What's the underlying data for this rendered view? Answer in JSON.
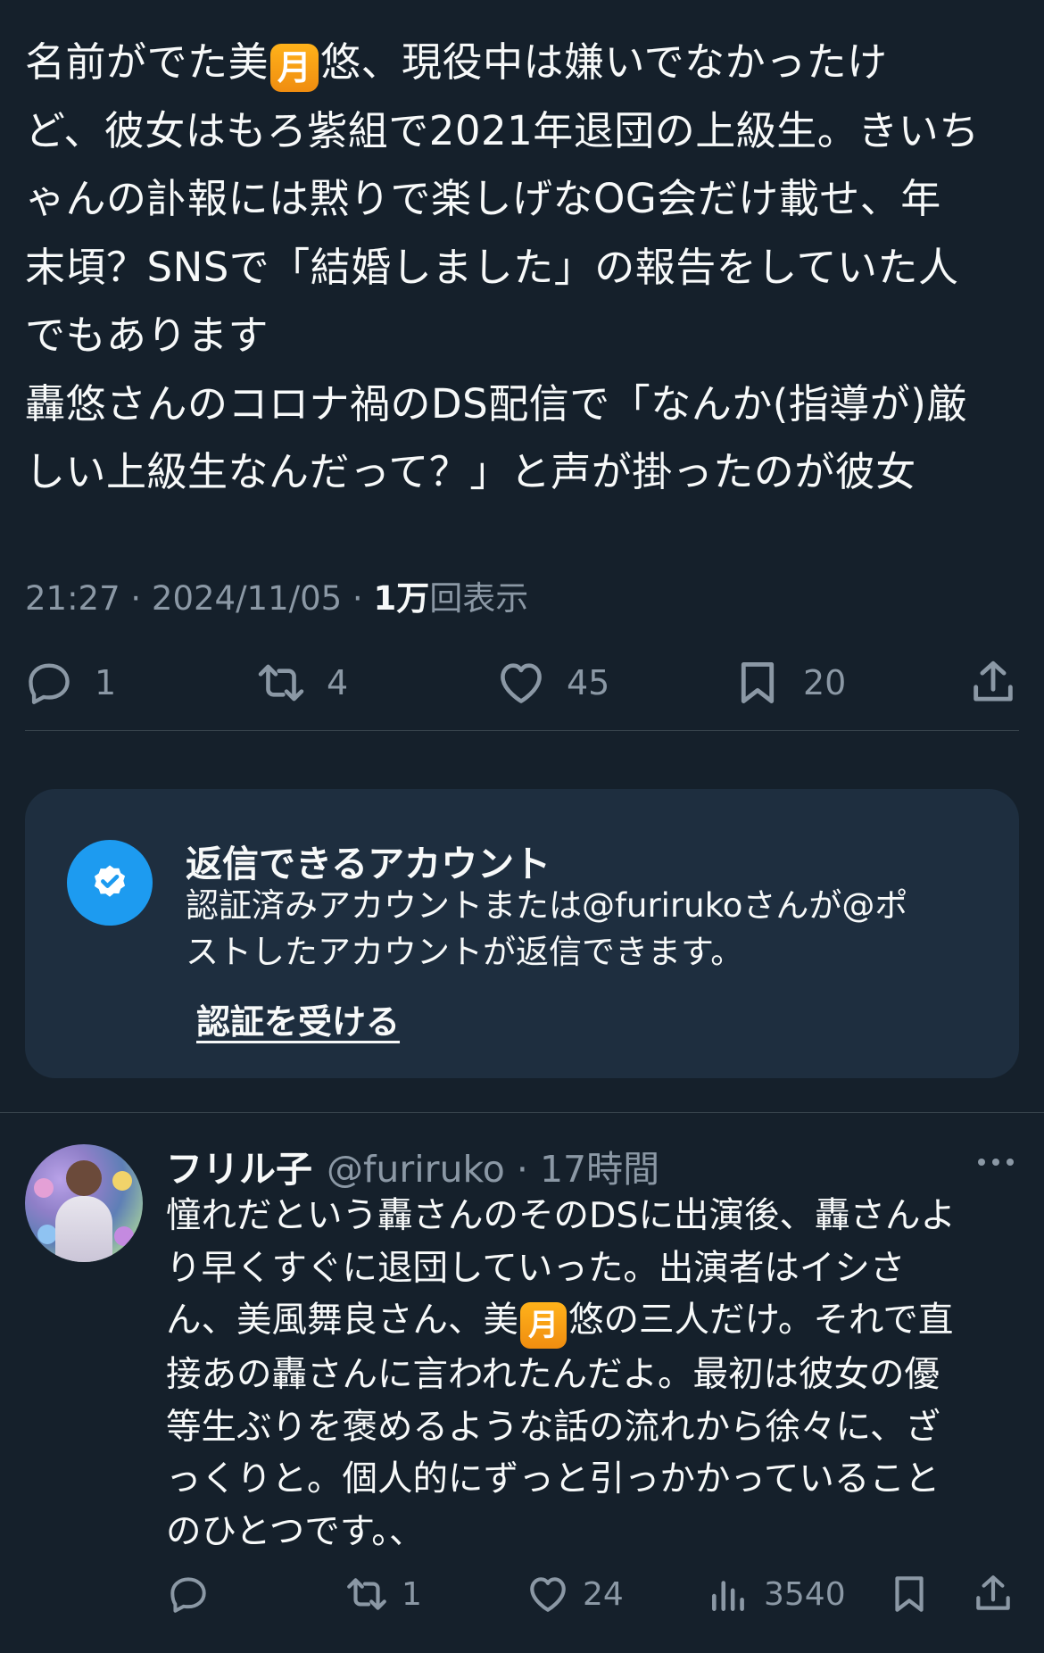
{
  "tweet": {
    "lines": [
      [
        "名前がでた美",
        "月",
        "悠、現役中は嫌いでなかったけ"
      ],
      "ど、彼女はもろ紫組で2021年退団の上級生。きいち",
      "ゃんの訃報には黙りで楽しげなOG会だけ載せ、年",
      "末頃？SNSで「結婚しました」の報告をしていた人",
      "でもあります",
      "轟悠さんのコロナ禍のDS配信で「なんか(指導が)厳",
      "しい上級生なんだって？」と声が掛ったのが彼女"
    ],
    "emoji_char": "月",
    "timestamp": "21:27 · 2024/11/05 · ",
    "views_count": "1万",
    "views_label": "回表示",
    "replies": "1",
    "retweets": "4",
    "likes": "45",
    "bookmarks": "20"
  },
  "reply_card": {
    "title": "返信できるアカウント",
    "desc_lines": [
      "認証済みアカウントまたは@furirukoさんが@ポ",
      "ストしたアカウントが返信できます。"
    ],
    "link": "認証を受ける"
  },
  "reply": {
    "name": "フリル子",
    "handle": "@furiruko · 17時間",
    "lines": [
      "憧れだという轟さんのそのDSに出演後、轟さんよ",
      "り早くすぐに退団していった。出演者はイシさ",
      [
        "ん、美風舞良さん、美",
        "月",
        "悠の三人だけ。それで直"
      ],
      "接あの轟さんに言われたんだよ。最初は彼女の優",
      "等生ぶりを褒めるような話の流れから徐々に、ざ",
      "っくりと。個人的にずっと引っかかっていること",
      "のひとつです。、"
    ],
    "replies": "",
    "retweets": "1",
    "likes": "24",
    "views": "3540"
  },
  "icons": {
    "reply": "reply-icon",
    "retweet": "retweet-icon",
    "like": "heart-icon",
    "bookmark": "bookmark-icon",
    "share": "share-icon",
    "views": "views-icon",
    "verified": "verified-badge-icon",
    "more": "more-icon"
  },
  "colors": {
    "background": "#15202b",
    "text": "#f7f9f9",
    "muted": "#8b98a5",
    "accent": "#1d9bf0",
    "card": "#1e2e3f"
  }
}
